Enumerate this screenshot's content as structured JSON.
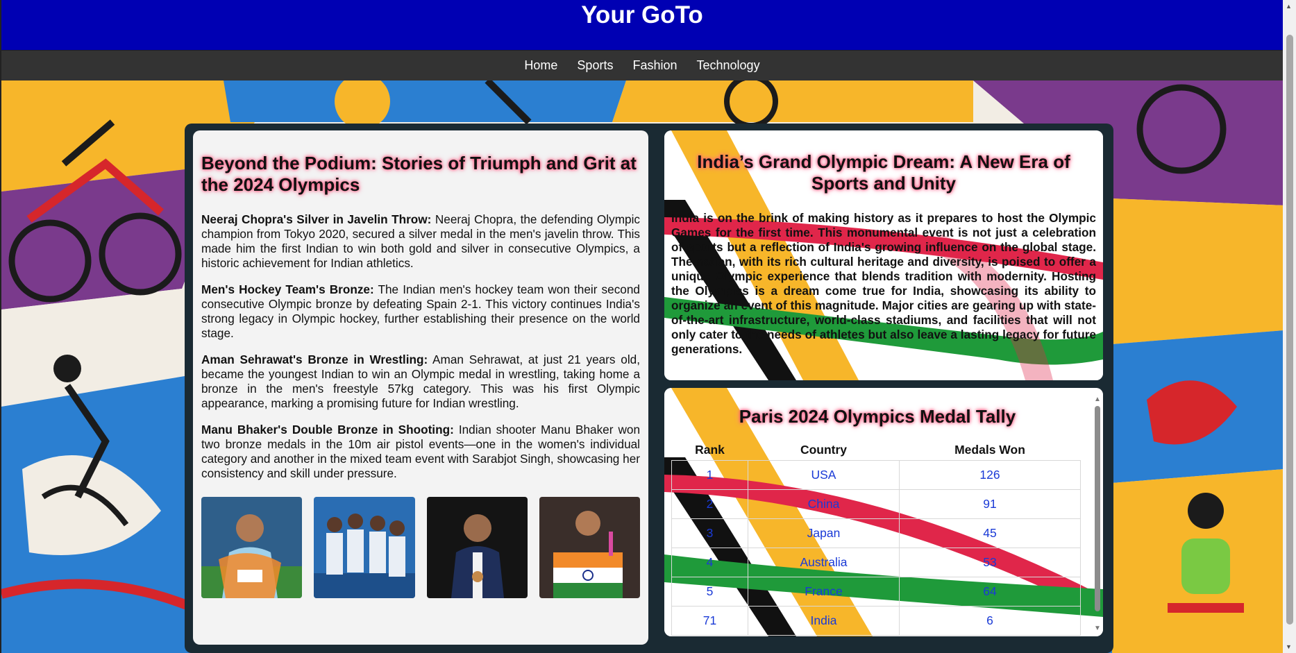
{
  "site_title": "Your GoTo",
  "nav": [
    "Home",
    "Sports",
    "Fashion",
    "Technology"
  ],
  "left_article": {
    "title": "Beyond the Podium: Stories of Triumph and Grit at the 2024 Olympics",
    "stories": [
      {
        "heading": "Neeraj Chopra's Silver in Javelin Throw:",
        "text": " Neeraj Chopra, the defending Olympic champion from Tokyo 2020, secured a silver medal in the men's javelin throw. This made him the first Indian to win both gold and silver in consecutive Olympics, a historic achievement for Indian athletics."
      },
      {
        "heading": "Men's Hockey Team's Bronze:",
        "text": " The Indian men's hockey team won their second consecutive Olympic bronze by defeating Spain 2-1. This victory continues India's strong legacy in Olympic hockey, further establishing their presence on the world stage."
      },
      {
        "heading": "Aman Sehrawat's Bronze in Wrestling:",
        "text": " Aman Sehrawat, at just 21 years old, became the youngest Indian to win an Olympic medal in wrestling, taking home a bronze in the men's freestyle 57kg category. This was his first Olympic appearance, marking a promising future for Indian wrestling."
      },
      {
        "heading": "Manu Bhaker's Double Bronze in Shooting:",
        "text": " Indian shooter Manu Bhaker won two bronze medals in the 10m air pistol events—one in the women's individual category and another in the mixed team event with Sarabjot Singh, showcasing her consistency and skill under pressure."
      }
    ]
  },
  "right_article": {
    "title": "India’s Grand Olympic Dream: A New Era of Sports and Unity",
    "text": "India is on the brink of making history as it prepares to host the Olympic Games for the first time. This monumental event is not just a celebration of sports but a reflection of India's growing influence on the global stage. The nation, with its rich cultural heritage and diversity, is poised to offer a unique Olympic experience that blends tradition with modernity. Hosting the Olympics is a dream come true for India, showcasing its ability to organize an event of this magnitude. Major cities are gearing up with state-of-the-art infrastructure, world-class stadiums, and facilities that will not only cater to the needs of athletes but also leave a lasting legacy for future generations."
  },
  "medal_tally": {
    "title": "Paris 2024 Olympics Medal Tally",
    "headers": [
      "Rank",
      "Country",
      "Medals Won"
    ],
    "rows": [
      [
        "1",
        "USA",
        "126"
      ],
      [
        "2",
        "China",
        "91"
      ],
      [
        "3",
        "Japan",
        "45"
      ],
      [
        "4",
        "Australia",
        "53"
      ],
      [
        "5",
        "France",
        "64"
      ],
      [
        "71",
        "India",
        "6"
      ]
    ]
  },
  "colors": {
    "header_bg": "#0000b3",
    "nav_bg": "#333333",
    "glow": "#ff3b6b",
    "table_text": "#1a3ad6"
  }
}
